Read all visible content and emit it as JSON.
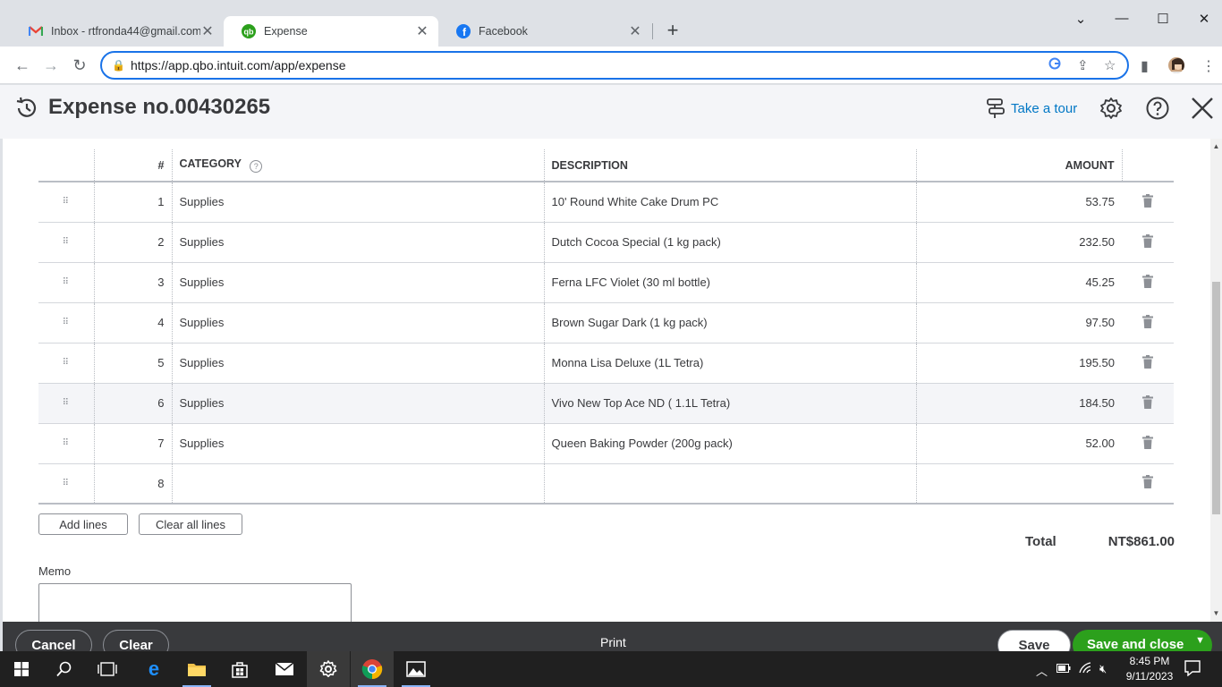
{
  "browser": {
    "tabs": [
      {
        "title": "Inbox - rtfronda44@gmail.com -",
        "icon": "gmail-icon"
      },
      {
        "title": "Expense",
        "icon": "quickbooks-icon"
      },
      {
        "title": "Facebook",
        "icon": "facebook-icon"
      }
    ],
    "url": "https://app.qbo.intuit.com/app/expense"
  },
  "header": {
    "title": "Expense no.00430265",
    "tour_label": "Take a tour"
  },
  "table": {
    "columns": {
      "num": "#",
      "category": "CATEGORY",
      "description": "DESCRIPTION",
      "amount": "AMOUNT"
    },
    "rows": [
      {
        "num": "1",
        "category": "Supplies",
        "description": "10' Round White Cake Drum PC",
        "amount": "53.75"
      },
      {
        "num": "2",
        "category": "Supplies",
        "description": "Dutch Cocoa Special (1 kg pack)",
        "amount": "232.50"
      },
      {
        "num": "3",
        "category": "Supplies",
        "description": "Ferna LFC Violet (30 ml bottle)",
        "amount": "45.25"
      },
      {
        "num": "4",
        "category": "Supplies",
        "description": "Brown Sugar Dark (1 kg pack)",
        "amount": "97.50"
      },
      {
        "num": "5",
        "category": "Supplies",
        "description": "Monna Lisa Deluxe (1L Tetra)",
        "amount": "195.50"
      },
      {
        "num": "6",
        "category": "Supplies",
        "description": "Vivo New Top Ace ND ( 1.1L Tetra)",
        "amount": "184.50"
      },
      {
        "num": "7",
        "category": "Supplies",
        "description": "Queen Baking Powder (200g pack)",
        "amount": "52.00"
      },
      {
        "num": "8",
        "category": "",
        "description": "",
        "amount": ""
      }
    ]
  },
  "actions": {
    "add_lines": "Add lines",
    "clear_all_lines": "Clear all lines"
  },
  "total": {
    "label": "Total",
    "value": "NT$861.00"
  },
  "memo": {
    "label": "Memo",
    "value": ""
  },
  "footer": {
    "cancel": "Cancel",
    "clear": "Clear",
    "print": "Print",
    "save": "Save",
    "save_and_close": "Save and close"
  },
  "taskbar": {
    "time": "8:45 PM",
    "date": "9/11/2023"
  },
  "colors": {
    "accent": "#0077c5",
    "save_green": "#2ca01c",
    "footer_bg": "#393a3d"
  }
}
